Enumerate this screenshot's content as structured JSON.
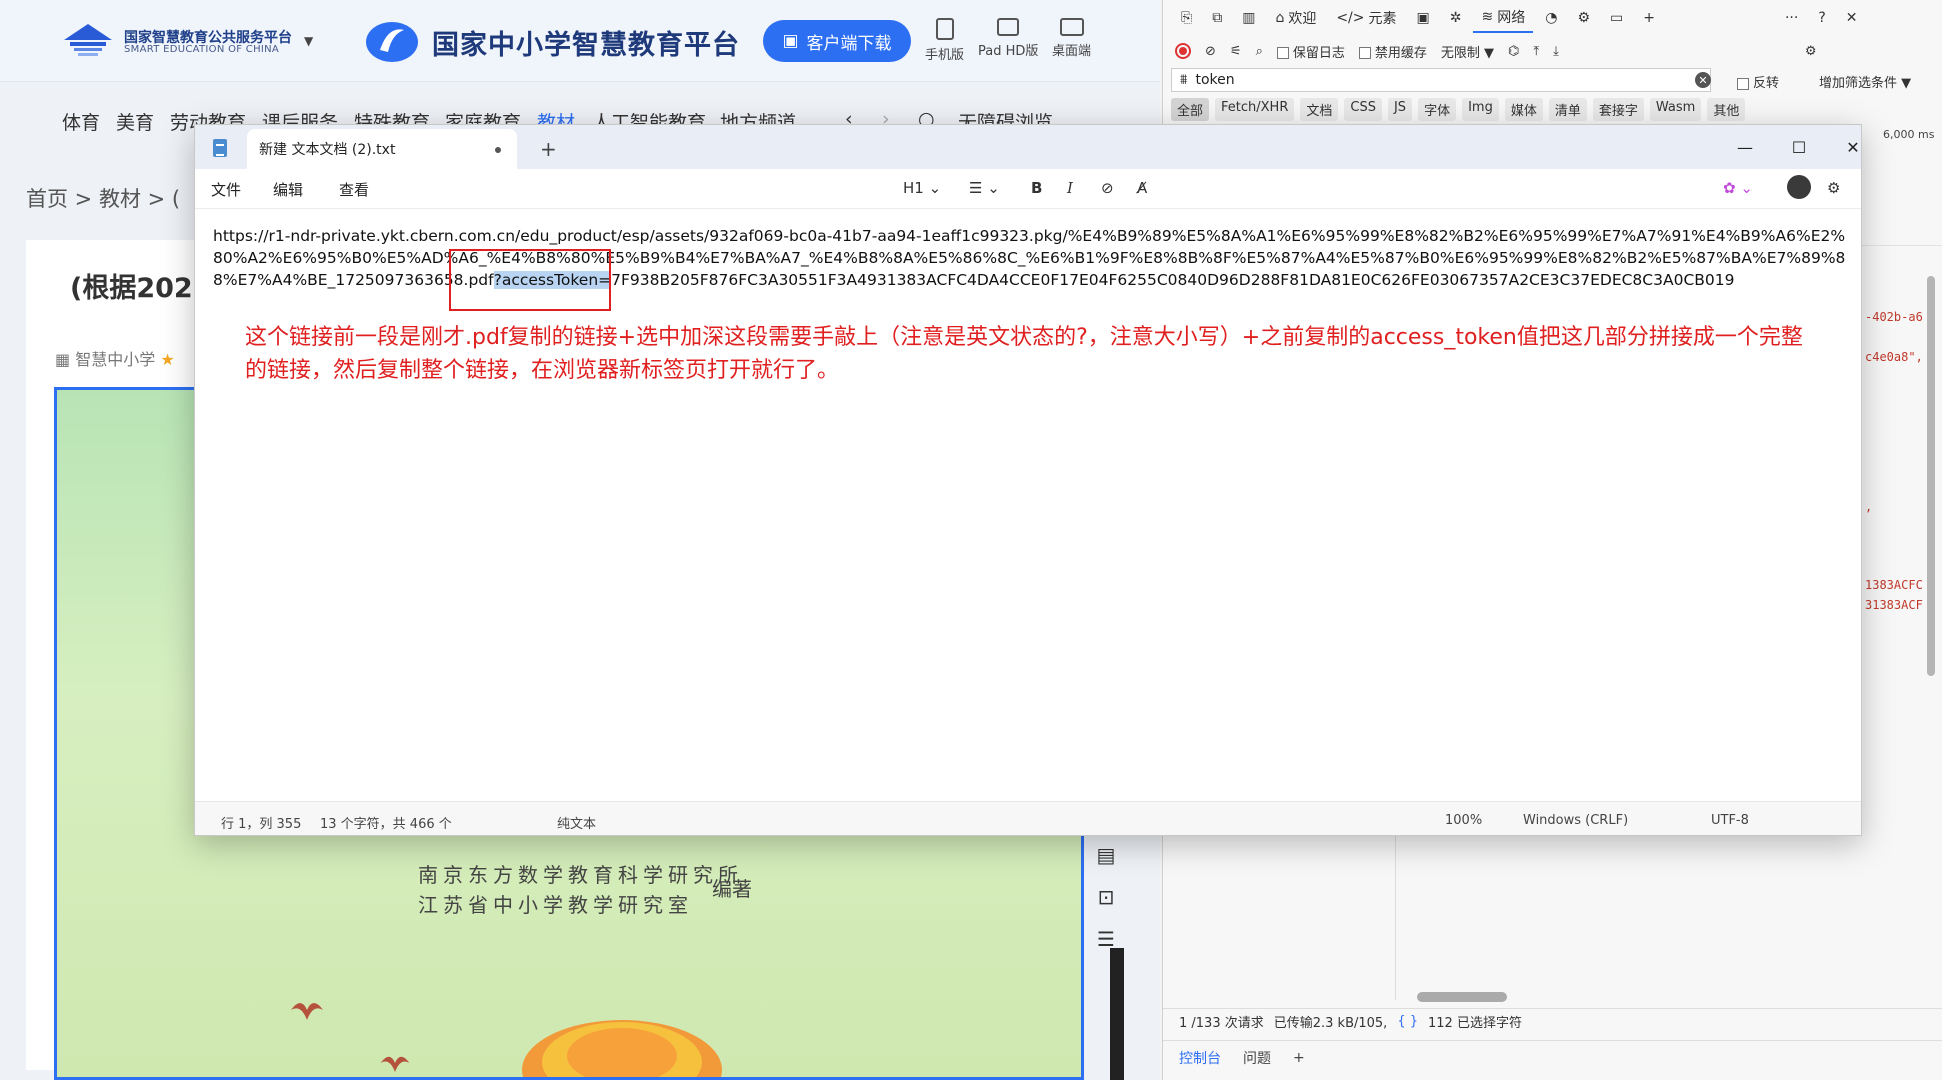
{
  "site": {
    "logo_line1": "国家智慧教育公共服务平台",
    "logo_line2": "SMART EDUCATION OF CHINA",
    "brand_name": "国家中小学智慧教育平台",
    "download_label": "客户端下载",
    "devices": [
      "手机版",
      "Pad HD版",
      "桌面端"
    ],
    "nav": [
      "体育",
      "美育",
      "劳动教育",
      "课后服务",
      "特殊教育",
      "家庭教育",
      "教材",
      "人工智能教育",
      "地方频道"
    ],
    "nav_active": "教材",
    "accessibility": "无障碍浏览",
    "breadcrumb": "首页  >  教材  >  (",
    "card_title": "(根据2022",
    "card_meta": "智慧中小学",
    "publisher_line1": "南京东方数学教育科学研究所",
    "publisher_line2": "江苏省中小学教学研究室",
    "compiler": "编著"
  },
  "devtools": {
    "tabs": [
      "欢迎",
      "元素",
      "网络"
    ],
    "active_tab": "网络",
    "preserve_log": "保留日志",
    "disable_cache": "禁用缓存",
    "throttle": "无限制",
    "filter_value": "token",
    "invert": "反转",
    "more_filters": "增加筛选条件",
    "types": [
      "全部",
      "Fetch/XHR",
      "文档",
      "CSS",
      "JS",
      "字体",
      "Img",
      "媒体",
      "清单",
      "套接字",
      "Wasm",
      "其他"
    ],
    "timeline_label": "6,000 ms",
    "snippets": [
      "-402b-a6",
      "c4e0a8\",",
      ",",
      "1383ACFC",
      "31383ACF"
    ],
    "status_requests": "1 /133 次请求",
    "status_transferred": "已传输2.3 kB/105,",
    "status_selected": "112 已选择字符",
    "bottom_tabs": [
      "控制台",
      "问题"
    ]
  },
  "notepad": {
    "tab_title": "新建 文本文档 (2).txt",
    "menus": [
      "文件",
      "编辑",
      "查看"
    ],
    "heading_tool": "H1",
    "content_before": "https://r1-ndr-private.ykt.cbern.com.cn/edu_product/esp/assets/932af069-bc0a-41b7-aa94-1eaff1c99323.pkg/%E4%B9%89%E5%8A%A1%E6%95%99%E8%82%B2%E6%95%99%E7%A7%91%E4%B9%A6%E2%80%A2%E6%95%B0%E5%AD%A6_%E4%B8%80%E5%B9%B4%E7%BA%A7_%E4%B8%8A%E5%86%8C_%E6%B1%9F%E8%8B%8F%E5%87%A4%E5%87%B0%E6%95%99%E8%82%B2%E5%87%BA%E7%89%88%E7%A4%BE_1725097363658.pdf",
    "content_selected": "?accessToken=",
    "content_after": "7F938B205F876FC3A30551F3A4931383ACFC4DA4CCE0F17E04F6255C0840D96D288F81DA81E0C626FE03067357A2CE3C37EDEC8C3A0CB019",
    "note": "这个链接前一段是刚才.pdf复制的链接+选中加深这段需要手敲上（注意是英文状态的?，注意大小写）+之前复制的access_token值把这几部分拼接成一个完整的链接，然后复制整个链接，在浏览器新标签页打开就行了。",
    "status_position": "行 1，列 355",
    "status_chars": "13 个字符，共 466 个",
    "status_format": "纯文本",
    "status_zoom": "100%",
    "status_eol": "Windows (CRLF)",
    "status_encoding": "UTF-8"
  }
}
